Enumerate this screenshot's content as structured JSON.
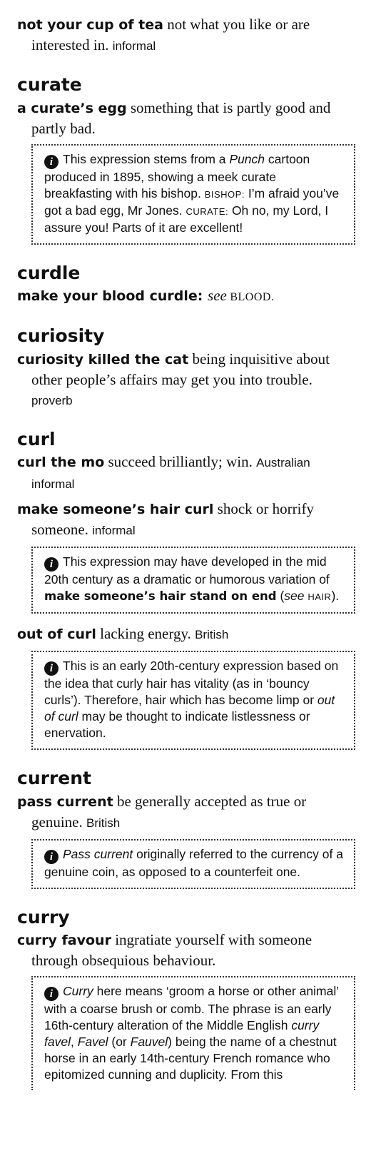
{
  "entries": [
    {
      "phrase": "not your cup of tea",
      "definition": " not what you like or are interested in.",
      "label": "informal"
    }
  ],
  "curate": {
    "headword": "curate",
    "phrase": "a curate’s egg",
    "definition": " something that is partly good and partly bad.",
    "note": {
      "t1": "This expression stems from a ",
      "t1_italic": "Punch",
      "t2": " cartoon produced in 1895, showing a meek curate breakfasting with his bishop. ",
      "sc1": "Bishop:",
      "t3": " I’m afraid you’ve got a bad egg, Mr Jones. ",
      "sc2": "Curate:",
      "t4": " Oh no, my Lord, I assure you! Parts of it are excellent!"
    }
  },
  "curdle": {
    "headword": "curdle",
    "phrase": "make your blood curdle",
    "colon": ": ",
    "see": "see",
    "xref": " BLOOD."
  },
  "curiosity": {
    "headword": "curiosity",
    "phrase": "curiosity killed the cat",
    "definition": " being inquisitive about other people’s affairs may get you into trouble.",
    "label": "proverb"
  },
  "curl": {
    "headword": "curl",
    "e1_phrase": "curl the mo",
    "e1_definition": " succeed brilliantly; win.",
    "e1_label": "Australian informal",
    "e2_phrase": "make someone’s hair curl",
    "e2_definition": " shock or horrify someone.",
    "e2_label": "informal",
    "note1": {
      "t1": "This expression may have developed in the mid 20th century as a dramatic or humorous variation of ",
      "bold": "make someone’s hair stand on end",
      "t2": " (",
      "see": "see",
      "sc": "hair",
      "t3": ")."
    },
    "e3_phrase": "out of curl",
    "e3_definition": " lacking energy.",
    "e3_label": "British",
    "note2": {
      "t1": "This is an early 20th-century expression based on the idea that curly hair has vitality (as in ‘bouncy curls’). Therefore, hair which has become limp or ",
      "italic": "out of curl",
      "t2": " may be thought to indicate listlessness or enervation."
    }
  },
  "current": {
    "headword": "current",
    "phrase": "pass current",
    "definition": " be generally accepted as true or genuine.",
    "label": "British",
    "note": {
      "italic": "Pass current",
      "t1": " originally referred to the currency of a genuine coin, as opposed to a counterfeit one."
    }
  },
  "curry": {
    "headword": "curry",
    "phrase": "curry favour",
    "definition": " ingratiate yourself with someone through obsequious behaviour.",
    "note": {
      "i1": "Curry",
      "t1": " here means ‘groom a horse or other animal’ with a coarse brush or comb. The phrase is an early 16th-century alteration of the Middle English ",
      "i2": "curry favel",
      "t2": ", ",
      "i3": "Favel",
      "t3": " (or ",
      "i4": "Fauvel",
      "t4": ") being the name of a chestnut horse in an early 14th-century French romance who epitomized cunning and duplicity. From this"
    }
  },
  "icon": {
    "info": "info-icon"
  }
}
